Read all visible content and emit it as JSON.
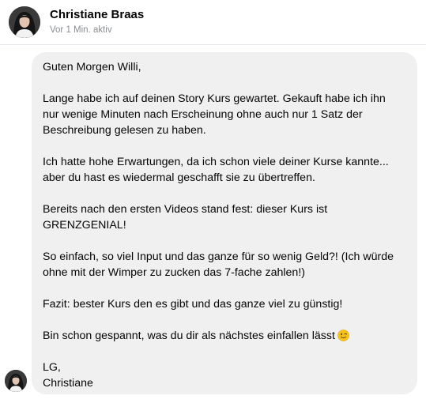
{
  "contact": {
    "name": "Christiane Braas",
    "status": "Vor 1 Min. aktiv"
  },
  "message": {
    "lines": {
      "l1": "Guten Morgen Willi,",
      "l2": "Lange habe ich auf deinen Story Kurs gewartet. Gekauft habe ich ihn",
      "l3": "nur wenige Minuten nach Erscheinung ohne auch nur 1 Satz der",
      "l4": "Beschreibung gelesen zu haben.",
      "l5": "Ich hatte hohe Erwartungen, da ich schon viele deiner Kurse kannte...",
      "l6": "aber du hast es wiedermal geschafft sie zu übertreffen.",
      "l7": "Bereits nach den ersten Videos stand fest: dieser Kurs ist",
      "l8": "GRENZGENIAL!",
      "l9": "So einfach, so viel Input und das ganze für so wenig Geld?! (Ich würde",
      "l10": "ohne mit der Wimper zu zucken das 7-fache zahlen!)",
      "l11": "Fazit: bester Kurs den es gibt und das ganze viel zu günstig!",
      "l12": "Bin schon gespannt, was du dir als nächstes einfallen lässt",
      "l13": "LG,",
      "l14": "Christiane"
    },
    "emoji": "winking-face-emoji"
  },
  "colors": {
    "bubble": "#f0f0f0",
    "text": "#050505",
    "status": "#8a8d91",
    "divider": "#e4e6eb"
  }
}
